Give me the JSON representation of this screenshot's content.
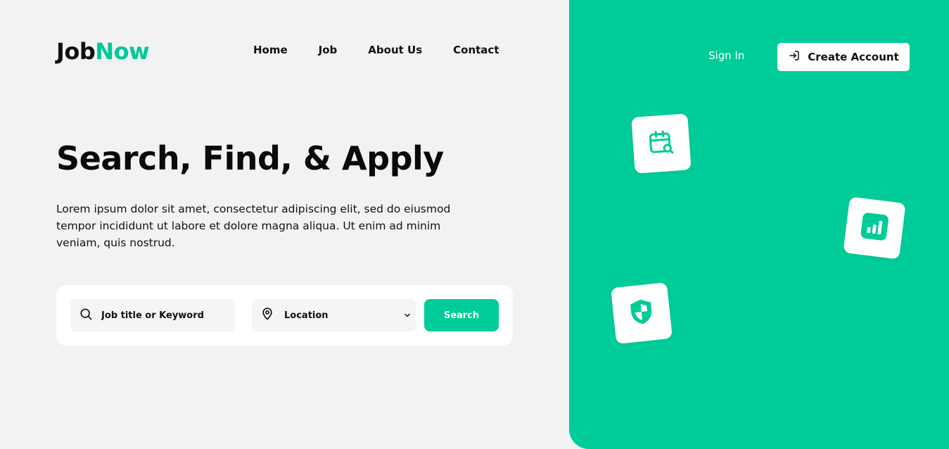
{
  "brand": {
    "logo_part1": "Job",
    "logo_part2": "Now",
    "accent_color": "#00cc99"
  },
  "nav": {
    "items": [
      {
        "label": "Home"
      },
      {
        "label": "Job"
      },
      {
        "label": "About Us"
      },
      {
        "label": "Contact"
      }
    ]
  },
  "auth": {
    "sign_in": "Sign In",
    "create_account": "Create Account",
    "create_account_icon": "login-icon"
  },
  "hero": {
    "title": "Search, Find, & Apply",
    "description": "Lorem ipsum dolor sit amet, consectetur adipiscing elit, sed do eiusmod tempor incididunt ut labore et dolore magna aliqua. Ut enim ad minim veniam, quis nostrud."
  },
  "search": {
    "keyword_placeholder": "Job title or Keyword",
    "location_selected": "Location",
    "button_label": "Search"
  },
  "tiles": [
    {
      "icon": "calendar-search-icon"
    },
    {
      "icon": "chart-icon"
    },
    {
      "icon": "shield-icon"
    }
  ]
}
